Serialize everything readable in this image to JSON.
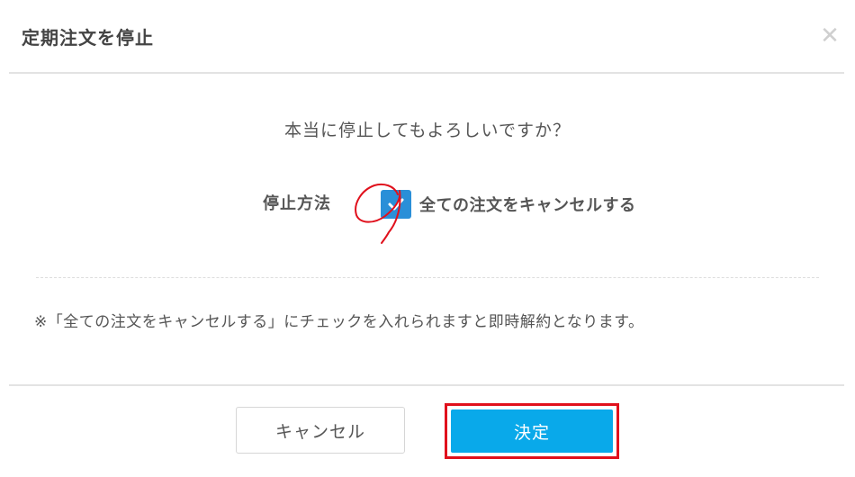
{
  "dialog": {
    "title": "定期注文を停止",
    "close_icon": "close-icon",
    "close_symbol": "✕"
  },
  "body": {
    "question": "本当に停止してもよろしいですか？",
    "method_label": "停止方法",
    "checkbox": {
      "checked": true,
      "label": "全ての注文をキャンセルする",
      "icon": "check-icon"
    },
    "note": "※「全ての注文をキャンセルする」にチェックを入れられますと即時解約となります。"
  },
  "footer": {
    "cancel_label": "キャンセル",
    "confirm_label": "決定"
  },
  "colors": {
    "checkbox": "#2a8fd8",
    "confirm_button": "#09a9ea",
    "annotation": "#e0101c",
    "text": "#555555"
  }
}
